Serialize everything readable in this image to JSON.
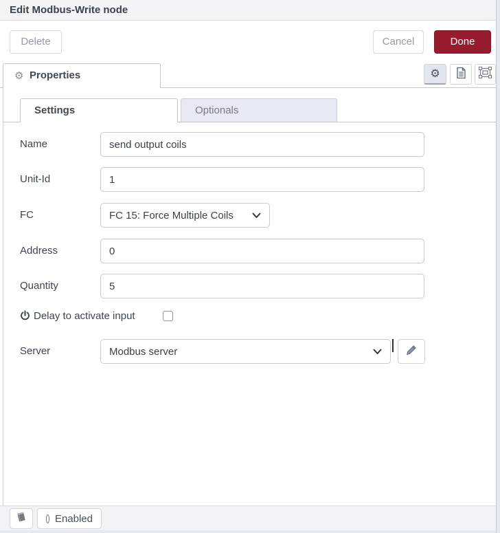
{
  "window": {
    "title": "Edit Modbus-Write node"
  },
  "toolbar": {
    "delete": "Delete",
    "cancel": "Cancel",
    "done": "Done"
  },
  "tray": {
    "properties_tab": "Properties"
  },
  "icons": {
    "gear": "⚙"
  },
  "form_tabs": {
    "settings": "Settings",
    "optionals": "Optionals"
  },
  "form": {
    "name": {
      "label": "Name",
      "value": "send output coils"
    },
    "unit_id": {
      "label": "Unit-Id",
      "value": "1"
    },
    "fc": {
      "label": "FC",
      "value": "FC 15: Force Multiple Coils"
    },
    "address": {
      "label": "Address",
      "value": "0"
    },
    "quantity": {
      "label": "Quantity",
      "value": "5"
    },
    "delay_to_activate": {
      "label": "Delay to activate input",
      "checked": false
    },
    "server": {
      "label": "Server",
      "value": "Modbus server"
    }
  },
  "footer": {
    "enabled": "Enabled"
  },
  "colors": {
    "done_bg": "#961B2D",
    "accent_bg": "#E8E9F3",
    "active_icon_bg": "#E3E5F0"
  }
}
